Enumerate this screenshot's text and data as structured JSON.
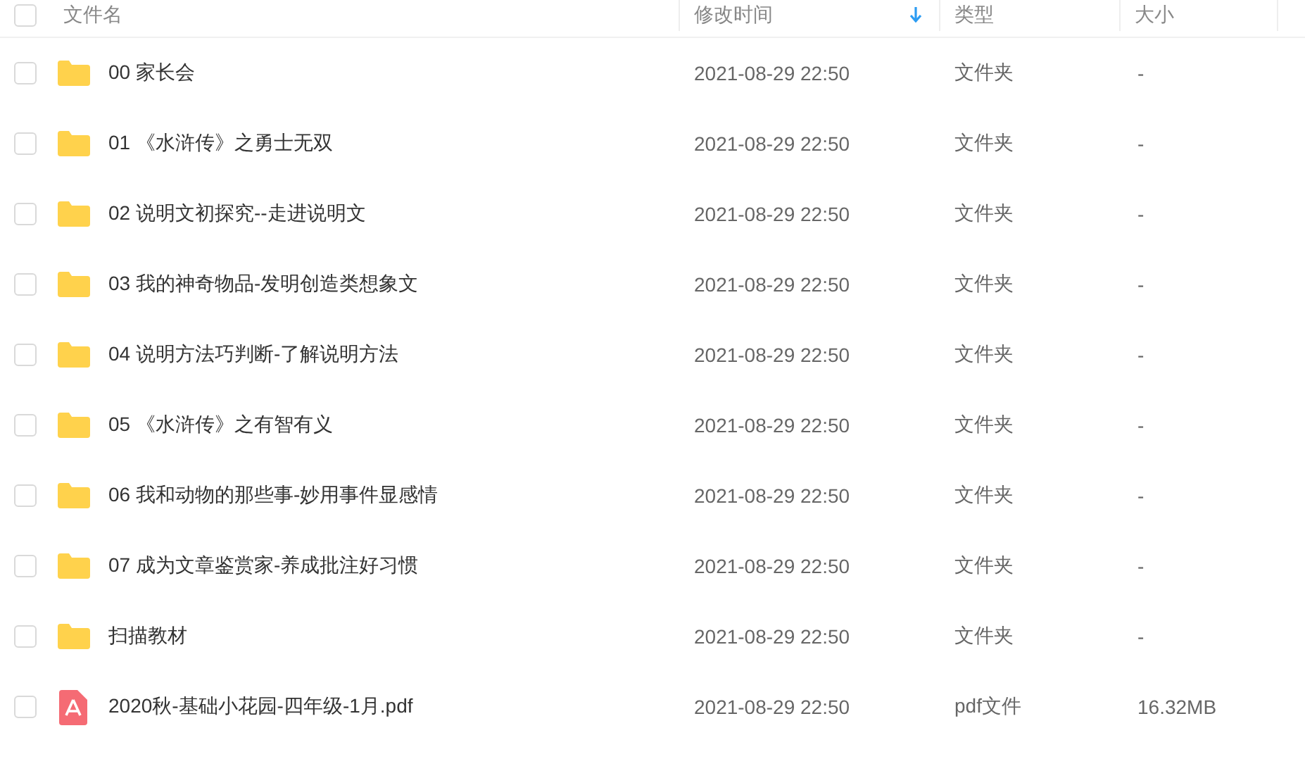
{
  "header": {
    "select_all_checked": false,
    "columns": [
      {
        "label": "文件名",
        "sorted": false
      },
      {
        "label": "修改时间",
        "sorted": true
      },
      {
        "label": "类型",
        "sorted": false
      },
      {
        "label": "大小",
        "sorted": false
      }
    ]
  },
  "files": [
    {
      "kind": "folder",
      "checked": false,
      "name": "00 家长会",
      "modified": "2021-08-29 22:50",
      "type": "文件夹",
      "size": "-"
    },
    {
      "kind": "folder",
      "checked": false,
      "name": "01 《水浒传》之勇士无双",
      "modified": "2021-08-29 22:50",
      "type": "文件夹",
      "size": "-"
    },
    {
      "kind": "folder",
      "checked": false,
      "name": "02 说明文初探究--走进说明文",
      "modified": "2021-08-29 22:50",
      "type": "文件夹",
      "size": "-"
    },
    {
      "kind": "folder",
      "checked": false,
      "name": "03 我的神奇物品-发明创造类想象文",
      "modified": "2021-08-29 22:50",
      "type": "文件夹",
      "size": "-"
    },
    {
      "kind": "folder",
      "checked": false,
      "name": "04 说明方法巧判断-了解说明方法",
      "modified": "2021-08-29 22:50",
      "type": "文件夹",
      "size": "-"
    },
    {
      "kind": "folder",
      "checked": false,
      "name": "05 《水浒传》之有智有义",
      "modified": "2021-08-29 22:50",
      "type": "文件夹",
      "size": "-"
    },
    {
      "kind": "folder",
      "checked": false,
      "name": "06 我和动物的那些事-妙用事件显感情",
      "modified": "2021-08-29 22:50",
      "type": "文件夹",
      "size": "-"
    },
    {
      "kind": "folder",
      "checked": false,
      "name": "07 成为文章鉴赏家-养成批注好习惯",
      "modified": "2021-08-29 22:50",
      "type": "文件夹",
      "size": "-"
    },
    {
      "kind": "folder",
      "checked": false,
      "name": "扫描教材",
      "modified": "2021-08-29 22:50",
      "type": "文件夹",
      "size": "-"
    },
    {
      "kind": "pdf",
      "checked": false,
      "name": "2020秋-基础小花园-四年级-1月.pdf",
      "modified": "2021-08-29 22:50",
      "type": "pdf文件",
      "size": "16.32MB"
    }
  ]
}
